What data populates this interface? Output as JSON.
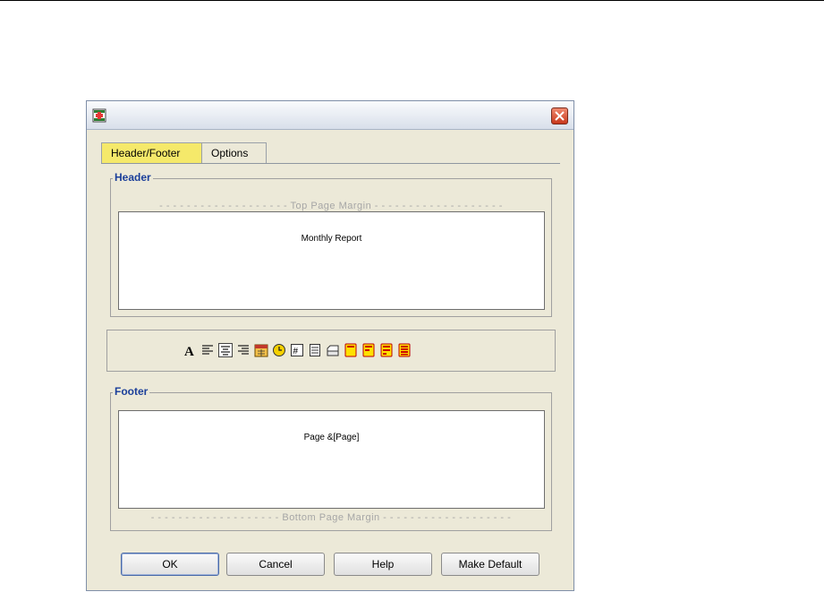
{
  "dialog": {
    "tabs": [
      {
        "label": "Header/Footer",
        "active": true
      },
      {
        "label": "Options",
        "active": false
      }
    ],
    "header": {
      "title": "Header",
      "top_margin_label": "- - - - - - - - - - - - - - - - - - - Top Page Margin - - - - - - - - - - - - - - - - - - -",
      "content": "Monthly Report"
    },
    "toolbar": {
      "icons": [
        "font-icon",
        "align-left-icon",
        "align-center-icon",
        "align-right-icon",
        "date-icon",
        "time-icon",
        "page-number-icon",
        "page-count-icon",
        "page-setup-icon",
        "insert-field-1-icon",
        "insert-field-2-icon",
        "insert-field-3-icon",
        "insert-field-4-icon"
      ]
    },
    "footer": {
      "title": "Footer",
      "content": "Page &[Page]",
      "bottom_margin_label": "- - - - - - - - - - - - - - - - - - - Bottom Page Margin - - - - - - - - - - - - - - - - - - -"
    },
    "buttons": {
      "ok": "OK",
      "cancel": "Cancel",
      "help": "Help",
      "make_default": "Make Default"
    }
  },
  "colors": {
    "dialog_bg": "#ece9d8",
    "active_tab": "#f5e96a",
    "group_title": "#1b3f9a",
    "close_button": "#c8381c"
  }
}
